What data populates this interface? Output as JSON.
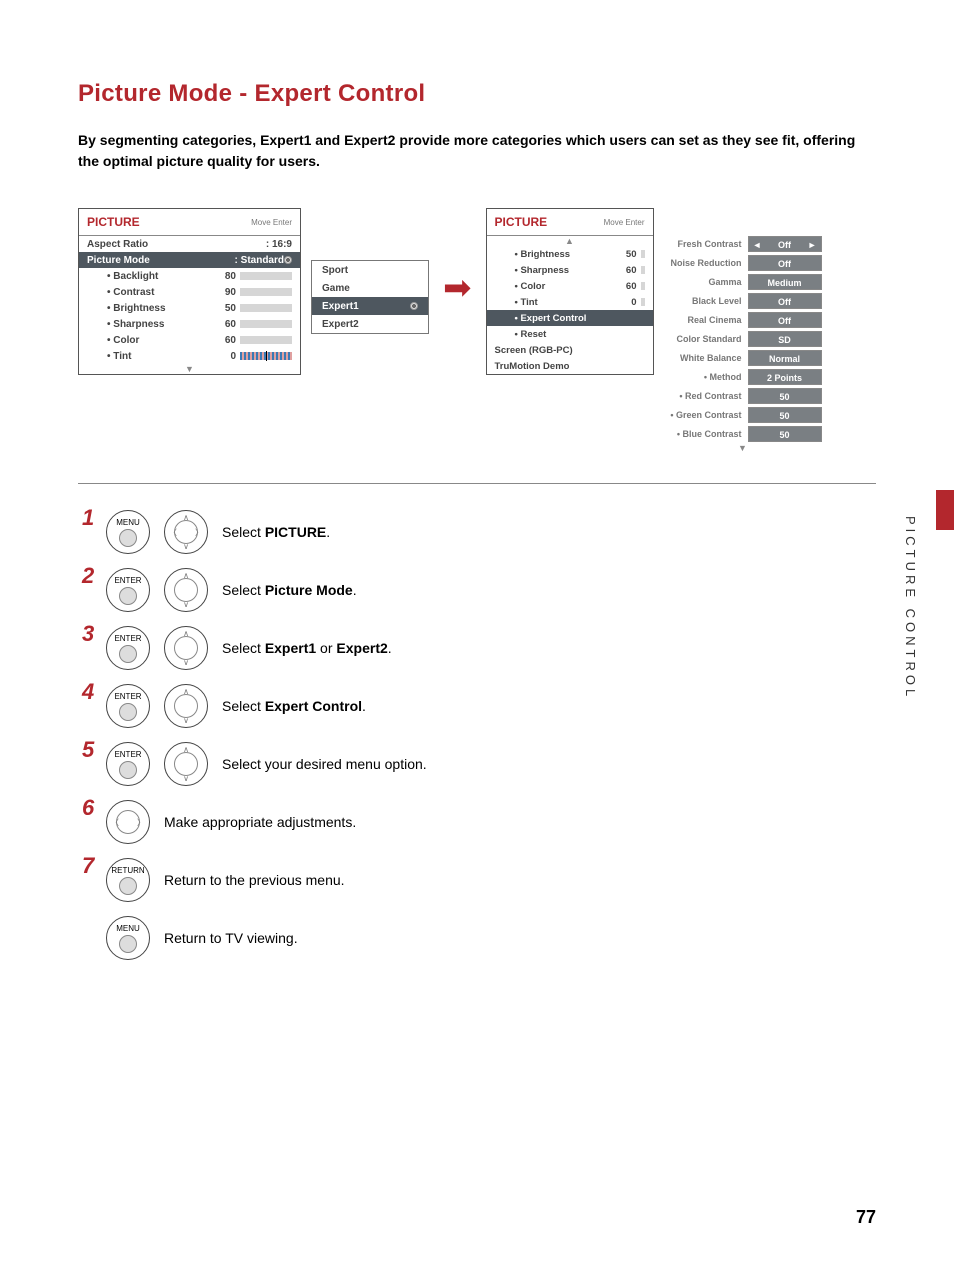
{
  "title": "Picture Mode - Expert Control",
  "intro_parts": {
    "p1": "By segmenting categories, ",
    "b1": "Expert1",
    "p2": " and ",
    "b2": "Expert2",
    "p3": " provide more categories which users can set as they see fit, offering the optimal picture quality for users."
  },
  "panel1": {
    "title": "PICTURE",
    "nav": "Move    Enter",
    "aspect_label": "Aspect Ratio",
    "aspect_val": ": 16:9",
    "mode_label": "Picture Mode",
    "mode_val": ": Standard",
    "items": [
      {
        "label": "• Backlight",
        "val": "80",
        "fill": 80
      },
      {
        "label": "• Contrast",
        "val": "90",
        "fill": 90
      },
      {
        "label": "• Brightness",
        "val": "50",
        "fill": 50
      },
      {
        "label": "• Sharpness",
        "val": "60",
        "fill": 60
      },
      {
        "label": "• Color",
        "val": "60",
        "fill": 60
      },
      {
        "label": "• Tint",
        "val": "0",
        "fill": -1
      }
    ]
  },
  "popup": {
    "items": [
      "Sport",
      "Game",
      "Expert1",
      "Expert2"
    ],
    "selected": "Expert1"
  },
  "panel2": {
    "title": "PICTURE",
    "nav": "Move    Enter",
    "items": [
      {
        "label": "• Brightness",
        "val": "50"
      },
      {
        "label": "• Sharpness",
        "val": "60"
      },
      {
        "label": "• Color",
        "val": "60"
      },
      {
        "label": "• Tint",
        "val": "0"
      },
      {
        "label": "• Expert Control",
        "val": "",
        "sel": true
      },
      {
        "label": "• Reset",
        "val": ""
      }
    ],
    "extra": [
      "Screen (RGB-PC)",
      "TruMotion Demo"
    ]
  },
  "settings": [
    {
      "name": "Fresh Contrast",
      "val": "Off",
      "arrows": true
    },
    {
      "name": "Noise Reduction",
      "val": "Off"
    },
    {
      "name": "Gamma",
      "val": "Medium"
    },
    {
      "name": "Black Level",
      "val": "Off"
    },
    {
      "name": "Real Cinema",
      "val": "Off"
    },
    {
      "name": "Color Standard",
      "val": "SD"
    },
    {
      "name": "White Balance",
      "val": "Normal"
    },
    {
      "name": "• Method",
      "val": "2 Points"
    },
    {
      "name": "• Red Contrast",
      "val": "50"
    },
    {
      "name": "• Green Contrast",
      "val": "50"
    },
    {
      "name": "• Blue Contrast",
      "val": "50"
    }
  ],
  "steps": [
    {
      "num": "1",
      "btn": "MENU",
      "wheel": "full",
      "txt_pre": "Select ",
      "txt_b": "PICTURE",
      "txt_post": "."
    },
    {
      "num": "2",
      "btn": "ENTER",
      "wheel": "ud",
      "txt_pre": "Select ",
      "txt_b": "Picture Mode",
      "txt_post": "."
    },
    {
      "num": "3",
      "btn": "ENTER",
      "wheel": "ud",
      "txt_pre": "Select ",
      "txt_b": "Expert1",
      "txt_mid": " or ",
      "txt_b2": "Expert2",
      "txt_post": "."
    },
    {
      "num": "4",
      "btn": "ENTER",
      "wheel": "ud",
      "txt_pre": "Select ",
      "txt_b": "Expert Control",
      "txt_post": "."
    },
    {
      "num": "5",
      "btn": "ENTER",
      "wheel": "ud",
      "txt_pre": "Select your desired menu option.",
      "txt_b": "",
      "txt_post": ""
    },
    {
      "num": "6",
      "btn": "",
      "wheel": "lr",
      "txt_pre": "Make appropriate adjustments.",
      "txt_b": "",
      "txt_post": ""
    },
    {
      "num": "7",
      "btn": "RETURN",
      "wheel": "",
      "txt_pre": "Return to the previous menu.",
      "txt_b": "",
      "txt_post": ""
    },
    {
      "num": "",
      "btn": "MENU",
      "wheel": "",
      "txt_pre": "Return to TV viewing.",
      "txt_b": "",
      "txt_post": ""
    }
  ],
  "side_label": "PICTURE CONTROL",
  "page_num": "77"
}
